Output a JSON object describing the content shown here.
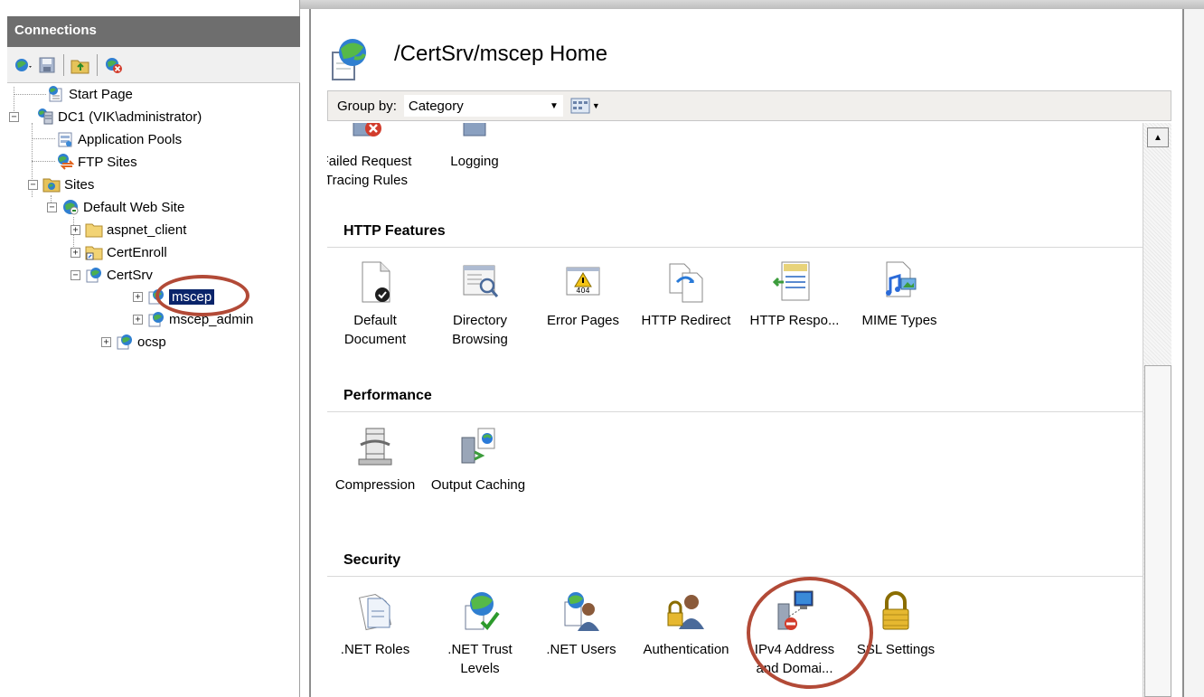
{
  "connections": {
    "title": "Connections",
    "tree": [
      {
        "label": "Start Page"
      },
      {
        "label": "DC1 (VIK\\administrator)"
      },
      {
        "label": "Application Pools"
      },
      {
        "label": "FTP Sites"
      },
      {
        "label": "Sites"
      },
      {
        "label": "Default Web Site"
      },
      {
        "label": "aspnet_client"
      },
      {
        "label": "CertEnroll"
      },
      {
        "label": "CertSrv"
      },
      {
        "label": "mscep"
      },
      {
        "label": "mscep_admin"
      },
      {
        "label": "ocsp"
      }
    ]
  },
  "main": {
    "title": "/CertSrv/mscep Home",
    "group_by_label": "Group by:",
    "group_by_value": "Category",
    "sections": {
      "http": "HTTP Features",
      "performance": "Performance",
      "security": "Security"
    },
    "features": {
      "failed_request": "Failed Request Tracing Rules",
      "logging": "Logging",
      "default_document": "Default Document",
      "directory_browsing": "Directory Browsing",
      "error_pages": "Error Pages",
      "http_redirect": "HTTP Redirect",
      "http_response": "HTTP Respo...",
      "mime_types": "MIME Types",
      "compression": "Compression",
      "output_caching": "Output Caching",
      "net_roles": ".NET Roles",
      "net_trust": ".NET Trust Levels",
      "net_users": ".NET Users",
      "authentication": "Authentication",
      "ipv4": "IPv4 Address and Domai...",
      "ssl": "SSL Settings",
      "error_badge": "404"
    }
  },
  "colors": {
    "header_gray": "#6e6e6e",
    "selection": "#0a246a",
    "highlight_ring": "#b24a37"
  }
}
